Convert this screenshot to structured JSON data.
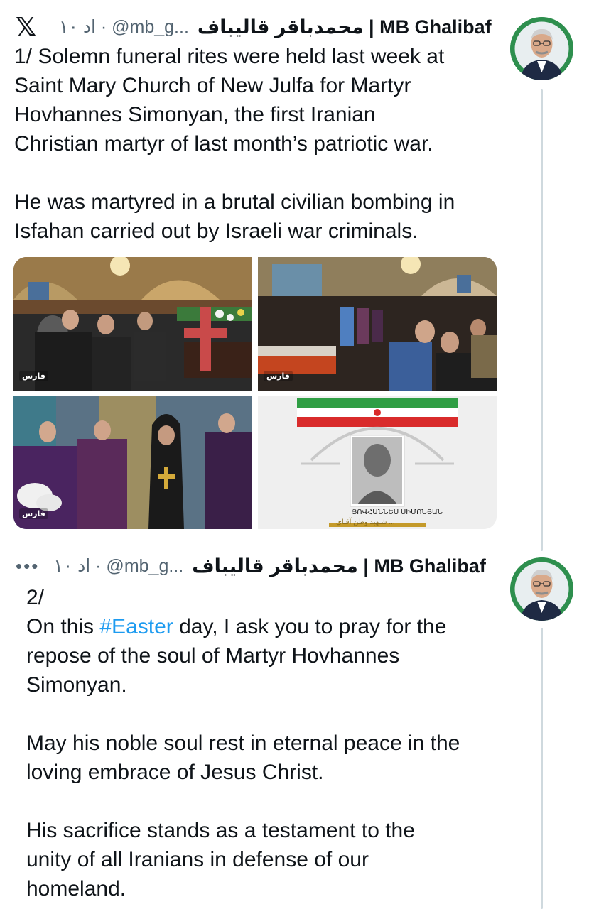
{
  "tweets": [
    {
      "author_name": "محمدباقر قالیباف | MB Ghalibaf",
      "meta": "۱۰ اد · @mb_g...",
      "platform_logo": "𝕏",
      "text": "1/ Solemn funeral rites were held last week at\nSaint Mary Church of New Julfa for Martyr\nHovhannes Simonyan, the first Iranian\nChristian martyr of last month’s patriotic war.\n\nHe was martyred in a brutal civilian bombing in\nIsfahan carried out by Israeli war criminals.",
      "images": [
        {
          "watermark": "فارس"
        },
        {
          "watermark": "فارس"
        },
        {
          "watermark": "فارس"
        },
        {
          "portrait_caption": "ՅՈՎՀԱՆՆԵՍ ՍԻՄՈՆՅԱՆ",
          "footer_text": "شـهید وطن آقـای ..."
        }
      ]
    },
    {
      "author_name": "محمدباقر قالیباف | MB Ghalibaf",
      "meta": "۱۰ اد · @mb_g...",
      "more": "•••",
      "prefix": "2/\nOn this ",
      "hashtag": "#Easter",
      "text_after_hashtag": " day, I ask you to pray for the\nrepose of the soul of Martyr Hovhannes\nSimonyan.\n\nMay his noble soul rest in eternal peace in the\nloving embrace of Jesus Christ.\n\nHis sacrifice stands as a testament to the\nunity of all Iranians in defense of our\nhomeland."
    }
  ],
  "colors": {
    "hashtag": "#1d9bf0",
    "thread_line": "#cfd9de",
    "secondary_text": "#536471",
    "avatar_ring": "#2e8f4e"
  },
  "icons": [
    "x-logo-icon",
    "more-icon"
  ]
}
